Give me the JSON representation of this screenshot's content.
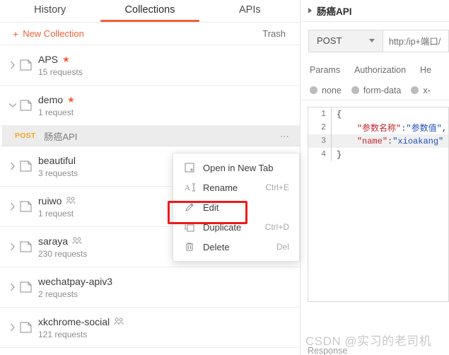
{
  "left": {
    "tabs": [
      {
        "label": "History",
        "active": false
      },
      {
        "label": "Collections",
        "active": true
      },
      {
        "label": "APIs",
        "active": false
      }
    ],
    "actions": {
      "new_collection": "New Collection",
      "plus": "+",
      "trash": "Trash"
    },
    "collections": [
      {
        "name": "APS",
        "sub": "15 requests",
        "starred": true,
        "team": false,
        "expanded": false
      },
      {
        "name": "demo",
        "sub": "1 request",
        "starred": true,
        "team": false,
        "expanded": true
      },
      {
        "name": "beautiful",
        "sub": "3 requests",
        "starred": false,
        "team": false,
        "expanded": false
      },
      {
        "name": "ruiwo",
        "sub": "1 request",
        "starred": false,
        "team": true,
        "expanded": false
      },
      {
        "name": "saraya",
        "sub": "230 requests",
        "starred": false,
        "team": true,
        "expanded": false
      },
      {
        "name": "wechatpay-apiv3",
        "sub": "2 requests",
        "starred": false,
        "team": false,
        "expanded": false
      },
      {
        "name": "xkchrome-social",
        "sub": "121 requests",
        "starred": false,
        "team": true,
        "expanded": false
      }
    ],
    "selected_request": {
      "method": "POST",
      "name": "肠癌API",
      "more": "⋯"
    }
  },
  "context_menu": {
    "items": [
      {
        "label": "Open in New Tab",
        "shortcut": "",
        "icon": "open-in-new-tab-icon"
      },
      {
        "label": "Rename",
        "shortcut": "Ctrl+E",
        "icon": "rename-icon"
      },
      {
        "label": "Edit",
        "shortcut": "",
        "icon": "edit-pencil-icon"
      },
      {
        "label": "Duplicate",
        "shortcut": "Ctrl+D",
        "icon": "duplicate-icon"
      },
      {
        "label": "Delete",
        "shortcut": "Del",
        "icon": "trash-icon"
      }
    ],
    "highlighted_item": "Edit",
    "highlight_color": "#ef1a1a"
  },
  "right": {
    "breadcrumb": "肠癌API",
    "method": "POST",
    "url_value": "http:/ip+端口/",
    "request_tabs": [
      {
        "label": "Params"
      },
      {
        "label": "Authorization"
      },
      {
        "label": "He"
      }
    ],
    "body_types": [
      {
        "label": "none"
      },
      {
        "label": "form-data"
      },
      {
        "label": "x-"
      }
    ],
    "code": {
      "lines": [
        {
          "no": "1",
          "current": false,
          "tokens": [
            {
              "t": "{",
              "c": "tok-brace"
            }
          ]
        },
        {
          "no": "2",
          "current": false,
          "tokens": [
            {
              "t": "    ",
              "c": "tok-punct"
            },
            {
              "t": "\"参数名称\"",
              "c": "tok-key"
            },
            {
              "t": ":",
              "c": "tok-punct"
            },
            {
              "t": "\"参数值\"",
              "c": "tok-val"
            },
            {
              "t": ",",
              "c": "tok-punct"
            }
          ]
        },
        {
          "no": "3",
          "current": true,
          "tokens": [
            {
              "t": "    ",
              "c": "tok-punct"
            },
            {
              "t": "\"name\"",
              "c": "tok-key"
            },
            {
              "t": ":",
              "c": "tok-punct"
            },
            {
              "t": "\"xioakang\"",
              "c": "tok-val"
            }
          ]
        },
        {
          "no": "4",
          "current": false,
          "tokens": [
            {
              "t": "}",
              "c": "tok-brace"
            }
          ]
        }
      ]
    },
    "response_label": "Response"
  },
  "watermark": "CSDN @实习的老司机",
  "colors": {
    "accent": "#f0603a",
    "method_post": "#f5a623",
    "highlight": "#ef1a1a",
    "selected_row_bg": "#ececec"
  }
}
